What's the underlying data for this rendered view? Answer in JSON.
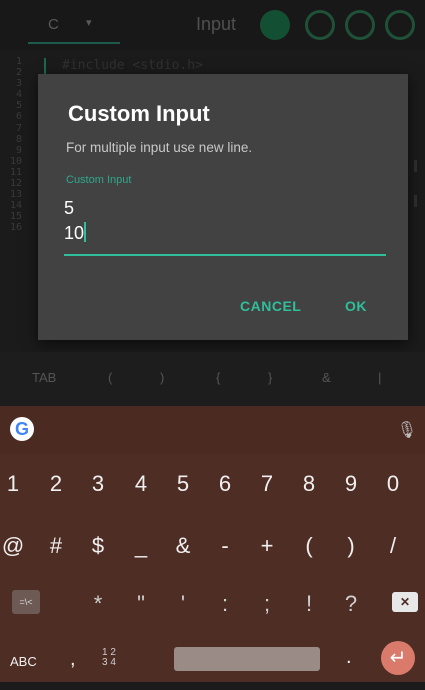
{
  "toolbar": {
    "language": "C",
    "language_arrow": "▾",
    "title": "Input"
  },
  "editor": {
    "line_numbers": [
      "1",
      "2",
      "3",
      "4",
      "5",
      "6",
      "7",
      "8",
      "9",
      "10",
      "11",
      "12",
      "13",
      "14",
      "15",
      "16"
    ],
    "first_line": "#include <stdio.h>"
  },
  "dialog": {
    "title": "Custom Input",
    "message": "For multiple input use new line.",
    "field_label": "Custom Input",
    "input_lines": [
      "5",
      "10"
    ],
    "cancel_label": "CANCEL",
    "ok_label": "OK"
  },
  "symbol_bar": [
    "TAB",
    "(",
    ")",
    "{",
    "}",
    "&",
    "|"
  ],
  "keyboard": {
    "numbers": [
      "1",
      "2",
      "3",
      "4",
      "5",
      "6",
      "7",
      "8",
      "9",
      "0"
    ],
    "symbols_row1": [
      "@",
      "#",
      "$",
      "_",
      "&",
      "-",
      "+",
      "(",
      ")",
      "/"
    ],
    "symbols_row2": [
      "*",
      "\"",
      "'",
      ":",
      ";",
      "!",
      "?"
    ],
    "bottom": {
      "abc": "ABC",
      "comma": ",",
      "numpad": "1 2\n3 4",
      "period": "."
    },
    "colors": {
      "background": "#4e2d25",
      "enter": "#d97a6b",
      "accent": "#2fbf9a"
    }
  }
}
